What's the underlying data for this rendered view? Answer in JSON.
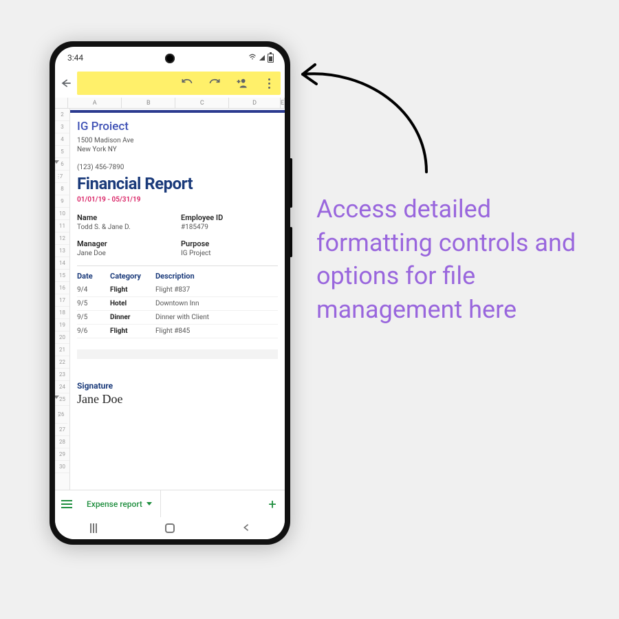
{
  "status": {
    "time": "3:44"
  },
  "columns": [
    "A",
    "B",
    "C",
    "D",
    "E"
  ],
  "rows": [
    "2",
    "3",
    "4",
    "5",
    "6",
    "7",
    "8",
    "9",
    "10",
    "11",
    "12",
    "13",
    "14",
    "15",
    "16",
    "17",
    "18",
    "19",
    "20",
    "21",
    "22",
    "23",
    "24",
    "25",
    "26",
    "27",
    "28",
    "29",
    "30"
  ],
  "group_rows": [
    "6",
    "25"
  ],
  "dot_rows": [
    "7",
    "26"
  ],
  "doc": {
    "company": "IG Proiect",
    "address1": "1500 Madison Ave",
    "address2": "New York NY",
    "phone": "(123) 456-7890",
    "title": "Financial Report",
    "daterange": "01/01/19 - 05/31/19",
    "name_label": "Name",
    "name_value": "Todd S. & Jane D.",
    "empid_label": "Employee ID",
    "empid_value": "#185479",
    "manager_label": "Manager",
    "manager_value": "Jane Doe",
    "purpose_label": "Purpose",
    "purpose_value": "IG Project",
    "col_date": "Date",
    "col_category": "Category",
    "col_description": "Description",
    "expenses": [
      {
        "date": "9/4",
        "category": "Flight",
        "description": "Flight #837"
      },
      {
        "date": "9/5",
        "category": "Hotel",
        "description": "Downtown Inn"
      },
      {
        "date": "9/5",
        "category": "Dinner",
        "description": "Dinner with Client"
      },
      {
        "date": "9/6",
        "category": "Flight",
        "description": "Flight #845"
      }
    ],
    "signature_label": "Signature",
    "signature_value": "Jane Doe"
  },
  "tabs": {
    "active": "Expense report"
  },
  "callout": "Access detailed formatting controls and options for file management here"
}
